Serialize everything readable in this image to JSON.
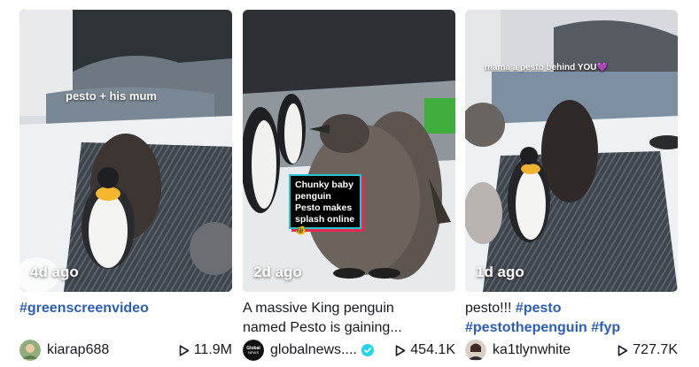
{
  "cards": [
    {
      "overlay": "pesto + his mum",
      "time": "4d ago",
      "caption_tag": "#greenscreenvideo",
      "username": "kiarap688",
      "views": "11.9M"
    },
    {
      "news_box": "Chunky baby penguin Pesto makes splash online 🐠",
      "time": "2d ago",
      "caption_line1": "A massive King penguin",
      "caption_line2": "named Pesto is gaining...",
      "username": "globalnews....",
      "avatar_text": "Global NEWS",
      "views": "454.1K"
    },
    {
      "overlay": "mama a pesto behind YOU💜",
      "time": "1d ago",
      "caption_text": "pesto!!! ",
      "caption_tag1": "#pesto",
      "caption_tag2": "#pestothepenguin",
      "caption_tag3": "#fyp",
      "username": "ka1tlynwhite",
      "views": "727.7K"
    }
  ],
  "icons": {
    "play": "play-icon",
    "verified": "verified-badge-icon"
  },
  "colors": {
    "hashtag": "#2b5db9",
    "verified": "#20d5ec",
    "news_border": "#29c3d3",
    "news_shadow": "#ea2a55"
  }
}
